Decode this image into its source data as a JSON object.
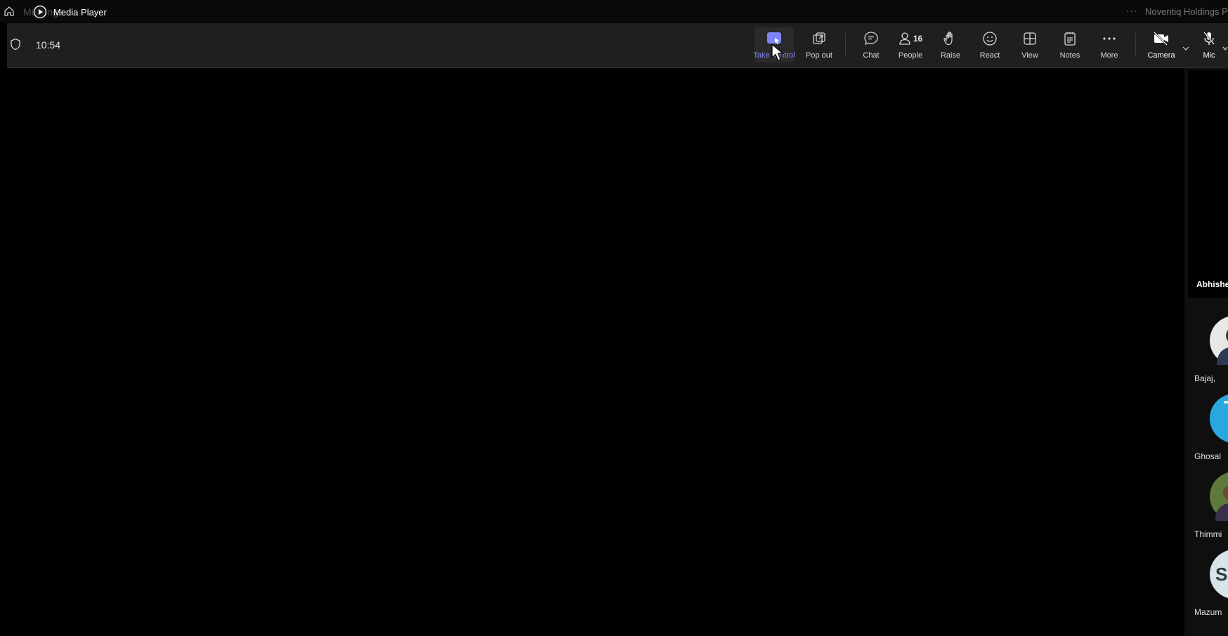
{
  "titlebar": {
    "ghost_text": "Meetings",
    "app_label": "Media Player",
    "org_name": "Noventiq Holdings PLC"
  },
  "toolbar": {
    "time": "10:54",
    "buttons": {
      "take_control": "Take control",
      "pop_out": "Pop out",
      "chat": "Chat",
      "people": "People",
      "people_count": "16",
      "raise": "Raise",
      "react": "React",
      "view": "View",
      "notes": "Notes",
      "more": "More",
      "camera": "Camera",
      "mic": "Mic"
    },
    "accent_color": "#7f85f5"
  },
  "participants": {
    "featured_name": "Abhishek",
    "list": [
      {
        "name": "Bajaj, ",
        "initial": "",
        "avatar_color": "#e8e8e8"
      },
      {
        "name": "Ghosal",
        "initial": "",
        "avatar_color": "#29a8e0"
      },
      {
        "name": "Thimmi",
        "initial": "",
        "avatar_color": "#5d7a3a"
      },
      {
        "name": "Mazum",
        "initial": "S",
        "avatar_color": "#d9e4ea"
      }
    ]
  }
}
